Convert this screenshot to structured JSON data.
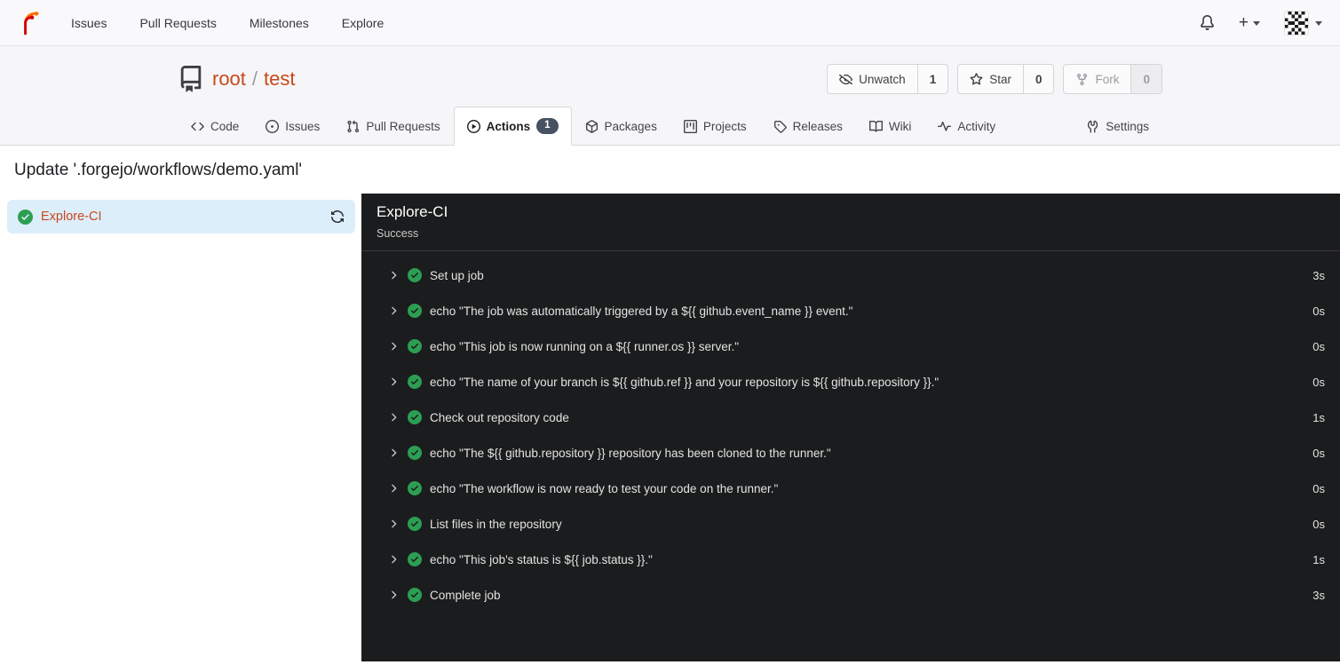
{
  "navbar": {
    "items": [
      {
        "label": "Issues"
      },
      {
        "label": "Pull Requests"
      },
      {
        "label": "Milestones"
      },
      {
        "label": "Explore"
      }
    ],
    "create_label": "+"
  },
  "repo": {
    "owner": "root",
    "separator": "/",
    "name": "test"
  },
  "repo_actions": {
    "unwatch": {
      "label": "Unwatch",
      "count": "1"
    },
    "star": {
      "label": "Star",
      "count": "0"
    },
    "fork": {
      "label": "Fork",
      "count": "0"
    }
  },
  "tabs": {
    "code": "Code",
    "issues": "Issues",
    "pulls": "Pull Requests",
    "actions": "Actions",
    "actions_badge": "1",
    "packages": "Packages",
    "projects": "Projects",
    "releases": "Releases",
    "wiki": "Wiki",
    "activity": "Activity",
    "settings": "Settings"
  },
  "page": {
    "title": "Update '.forgejo/workflows/demo.yaml'"
  },
  "sidebar": {
    "job": {
      "name": "Explore-CI"
    }
  },
  "run": {
    "title": "Explore-CI",
    "status": "Success",
    "steps": [
      {
        "name": "Set up job",
        "duration": "3s"
      },
      {
        "name": "echo \"The job was automatically triggered by a ${{ github.event_name }} event.\"",
        "duration": "0s"
      },
      {
        "name": "echo \"This job is now running on a ${{ runner.os }} server.\"",
        "duration": "0s"
      },
      {
        "name": "echo \"The name of your branch is ${{ github.ref }} and your repository is ${{ github.repository }}.\"",
        "duration": "0s"
      },
      {
        "name": "Check out repository code",
        "duration": "1s"
      },
      {
        "name": "echo \"The ${{ github.repository }} repository has been cloned to the runner.\"",
        "duration": "0s"
      },
      {
        "name": "echo \"The workflow is now ready to test your code on the runner.\"",
        "duration": "0s"
      },
      {
        "name": "List files in the repository",
        "duration": "0s"
      },
      {
        "name": "echo \"This job's status is ${{ job.status }}.\"",
        "duration": "1s"
      },
      {
        "name": "Complete job",
        "duration": "3s"
      }
    ]
  },
  "colors": {
    "accent": "#c8481b",
    "success_green": "#2c9e53",
    "panel_bg": "#1b1c1d",
    "selected_bg": "#ddeefb",
    "badge_bg": "#465261"
  }
}
